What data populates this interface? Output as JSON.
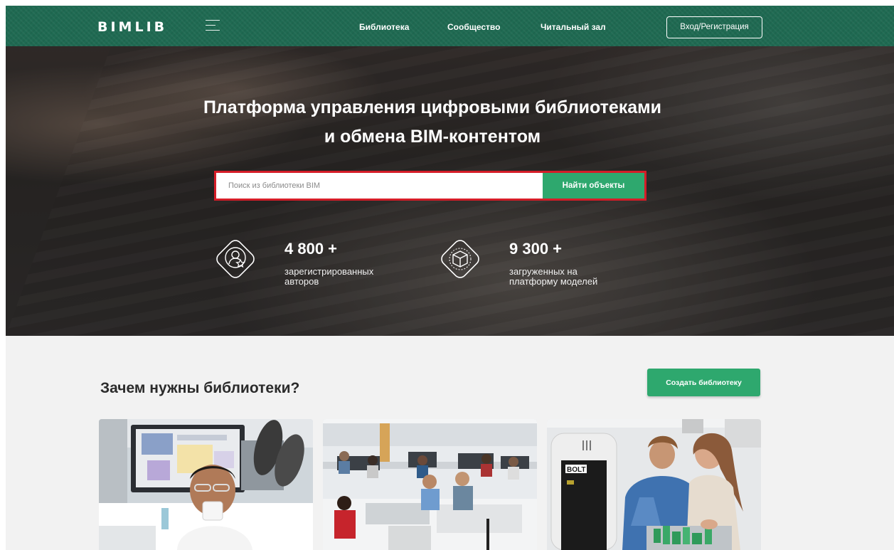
{
  "header": {
    "logo": "BIMLIB",
    "nav": [
      "Библиотека",
      "Сообщество",
      "Читальный зал"
    ],
    "login_label": "Вход/Регистрация"
  },
  "hero": {
    "title_line1": "Платформа управления цифровыми библиотеками",
    "title_line2": "и обмена BIM-контентом",
    "search": {
      "placeholder": "Поиск из библиотеки BIM",
      "button_label": "Найти объекты"
    },
    "stats": [
      {
        "value": "4 800 +",
        "label_line1": "зарегистрированных",
        "label_line2": "авторов",
        "icon": "author-star-icon"
      },
      {
        "value": "9 300 +",
        "label_line1": "загруженных на",
        "label_line2": "платформу моделей",
        "icon": "cube-icon"
      }
    ]
  },
  "content": {
    "section_title": "Зачем нужны библиотеки?",
    "create_button": "Создать библиотеку",
    "cards": [
      {
        "icon": "office-worker-photo"
      },
      {
        "icon": "open-office-photo"
      },
      {
        "icon": "team-bolt-photo",
        "sign_text": "BOLT"
      }
    ]
  },
  "colors": {
    "header_green": "#1f6a52",
    "accent_green": "#2ea86e",
    "search_outline": "#d51d28"
  }
}
